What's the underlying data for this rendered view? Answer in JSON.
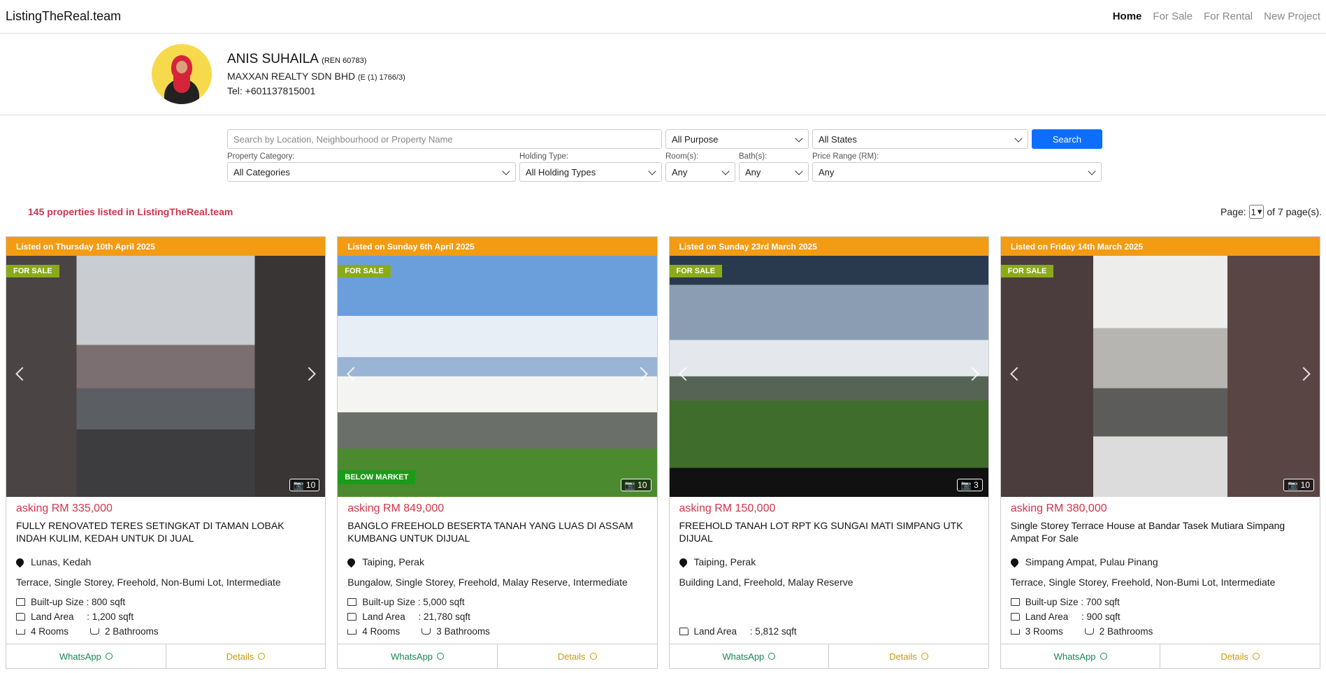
{
  "brand": "ListingTheReal.team",
  "nav": [
    "Home",
    "For Sale",
    "For Rental",
    "New Project"
  ],
  "agent": {
    "name": "ANIS SUHAILA",
    "reg": "(REN 60783)",
    "company": "MAXXAN REALTY SDN BHD",
    "company_reg": "(E (1) 1766/3)",
    "tel": "Tel: +601137815001"
  },
  "search": {
    "placeholder": "Search by Location, Neighbourhood or Property Name",
    "purpose": "All Purpose",
    "states": "All States",
    "button": "Search",
    "category_label": "Property Category:",
    "category": "All Categories",
    "holding_label": "Holding Type:",
    "holding": "All Holding Types",
    "rooms_label": "Room(s):",
    "rooms": "Any",
    "baths_label": "Bath(s):",
    "baths": "Any",
    "price_label": "Price Range (RM):",
    "price": "Any"
  },
  "summary": {
    "count": "145 properties listed in ListingTheReal.team",
    "page_label": "Page:",
    "page": "1",
    "of": "of 7 page(s)."
  },
  "listings": [
    {
      "date": "Listed on Thursday 10th April 2025",
      "tag": "FOR SALE",
      "tag2": "",
      "photos": "10",
      "price": "asking RM 335,000",
      "title": "FULLY RENOVATED TERES SETINGKAT DI TAMAN LOBAK INDAH KULIM, KEDAH UNTUK DI JUAL",
      "location": "Lunas, Kedah",
      "features": "Terrace, Single Storey, Freehold, Non-Bumi Lot, Intermediate",
      "builtup": "Built-up Size : 800 sqft",
      "land": "Land Area     : 1,200 sqft",
      "rooms": "4 Rooms",
      "baths": "2 Bathrooms"
    },
    {
      "date": "Listed on Sunday 6th April 2025",
      "tag": "FOR SALE",
      "tag2": "BELOW MARKET",
      "photos": "10",
      "price": "asking RM 849,000",
      "title": "BANGLO FREEHOLD BESERTA TANAH YANG LUAS DI ASSAM KUMBANG UNTUK DIJUAL",
      "location": "Taiping, Perak",
      "features": "Bungalow, Single Storey, Freehold, Malay Reserve, Intermediate",
      "builtup": "Built-up Size : 5,000 sqft",
      "land": "Land Area     : 21,780 sqft",
      "rooms": "4 Rooms",
      "baths": "3 Bathrooms"
    },
    {
      "date": "Listed on Sunday 23rd March 2025",
      "tag": "FOR SALE",
      "tag2": "",
      "photos": "3",
      "price": "asking RM 150,000",
      "title": "FREEHOLD TANAH LOT RPT KG SUNGAI MATI SIMPANG UTK DIJUAL",
      "location": "Taiping, Perak",
      "features": "Building Land, Freehold, Malay Reserve",
      "builtup": "",
      "land": "Land Area     : 5,812 sqft",
      "rooms": "",
      "baths": ""
    },
    {
      "date": "Listed on Friday 14th March 2025",
      "tag": "FOR SALE",
      "tag2": "",
      "photos": "10",
      "price": "asking RM 380,000",
      "title": "Single Storey Terrace House at Bandar Tasek Mutiara Simpang Ampat For Sale",
      "location": "Simpang Ampat, Pulau Pinang",
      "features": "Terrace, Single Storey, Freehold, Non-Bumi Lot, Intermediate",
      "builtup": "Built-up Size : 700 sqft",
      "land": "Land Area     : 900 sqft",
      "rooms": "3 Rooms",
      "baths": "2 Bathrooms"
    }
  ],
  "actions": {
    "whatsapp": "WhatsApp",
    "details": "Details"
  },
  "colors": {
    "accent": "#0d6efd",
    "date_bar": "#f39b12",
    "price": "#d1354a",
    "tag": "#8bab16"
  }
}
